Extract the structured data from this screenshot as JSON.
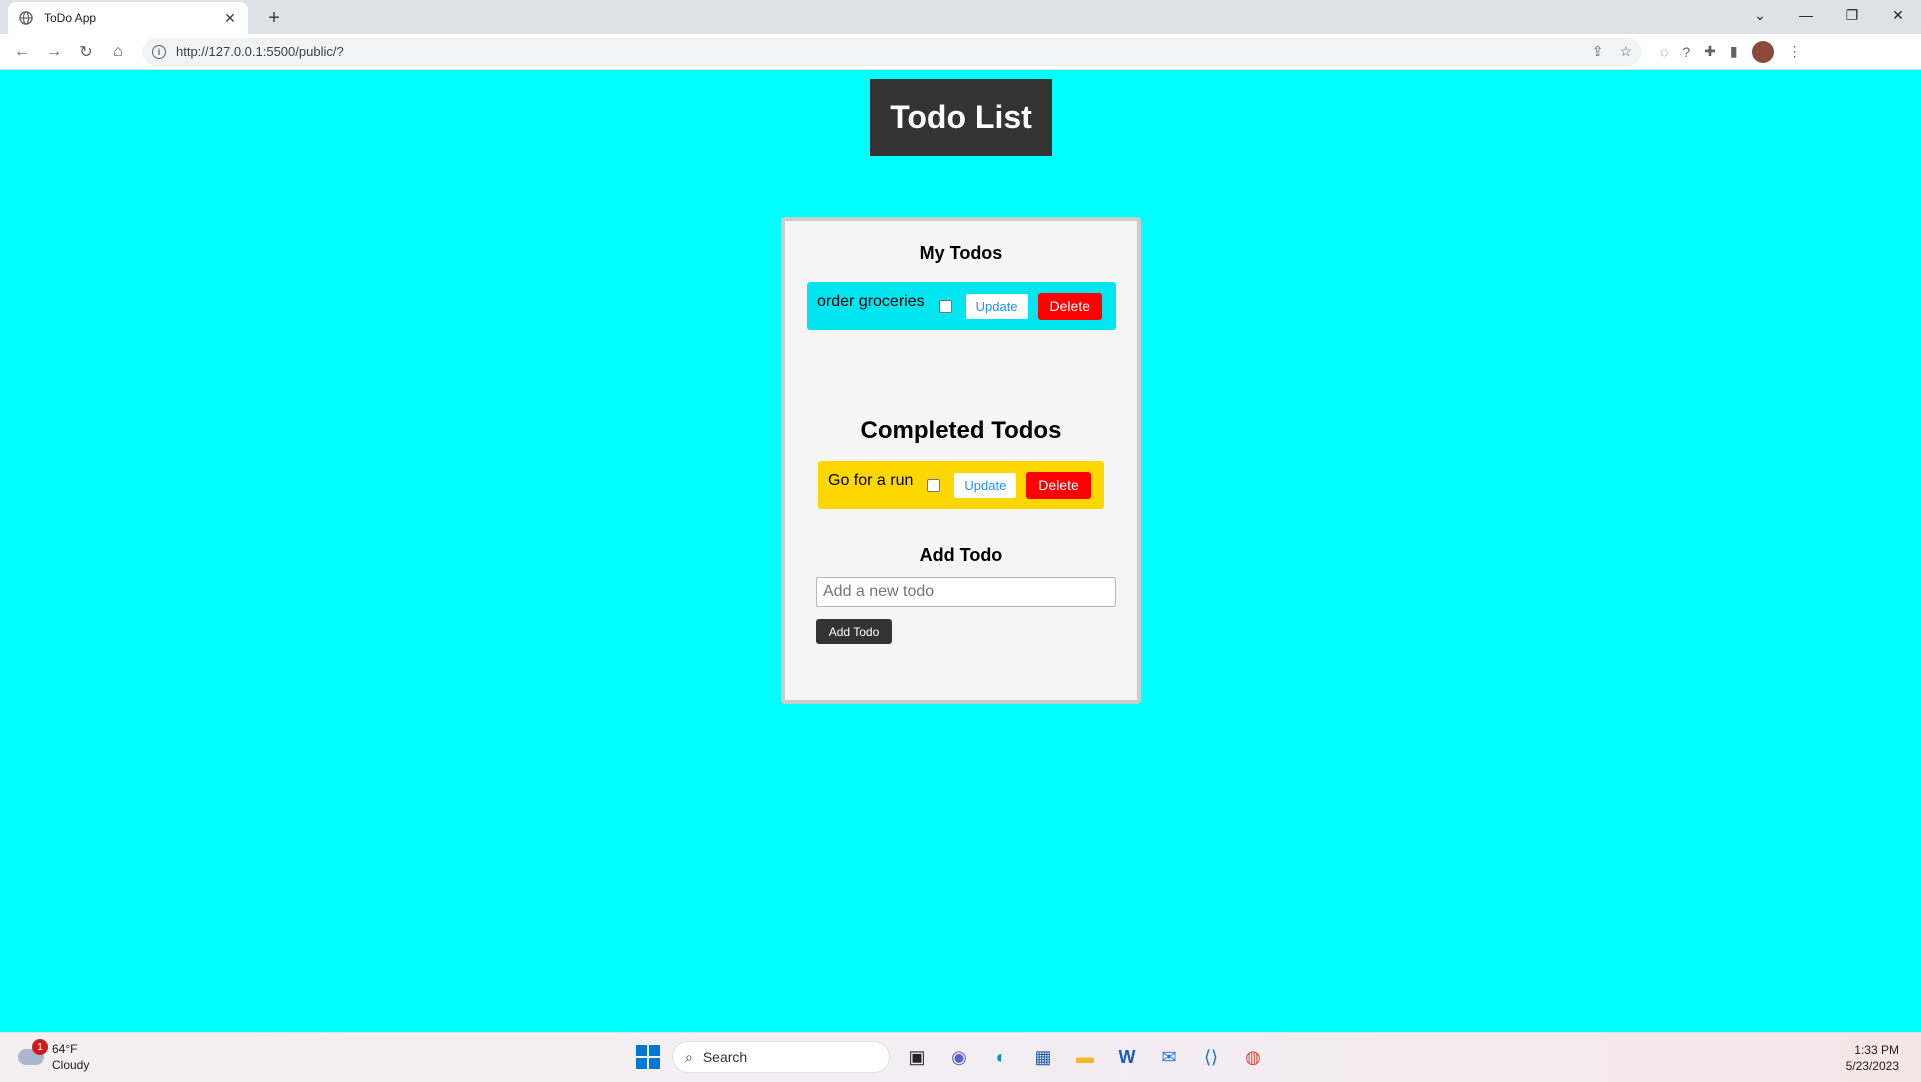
{
  "browser": {
    "tab_title": "ToDo App",
    "url": "http://127.0.0.1:5500/public/?",
    "new_tab_label": "+",
    "close_tab_label": "✕"
  },
  "page": {
    "header_title": "Todo List",
    "my_todos_title": "My Todos",
    "completed_title": "Completed Todos",
    "add_title": "Add Todo",
    "pending_todos": [
      {
        "text": "order groceries",
        "checked": false,
        "update_label": "Update",
        "delete_label": "Delete"
      }
    ],
    "completed_todos": [
      {
        "text": "Go for a run",
        "checked": false,
        "update_label": "Update",
        "delete_label": "Delete"
      }
    ],
    "add_input_placeholder": "Add a new todo",
    "add_button_label": "Add Todo"
  },
  "colors": {
    "page_bg": "#00ffff",
    "header_bg": "#333333",
    "pending_bg": "#00e5f0",
    "completed_bg": "#ffd700",
    "delete_bg": "#ff0000",
    "update_text": "#1e90ff"
  },
  "taskbar": {
    "weather_temp": "64°F",
    "weather_desc": "Cloudy",
    "weather_badge": "1",
    "search_label": "Search",
    "time": "1:33 PM",
    "date": "5/23/2023"
  }
}
